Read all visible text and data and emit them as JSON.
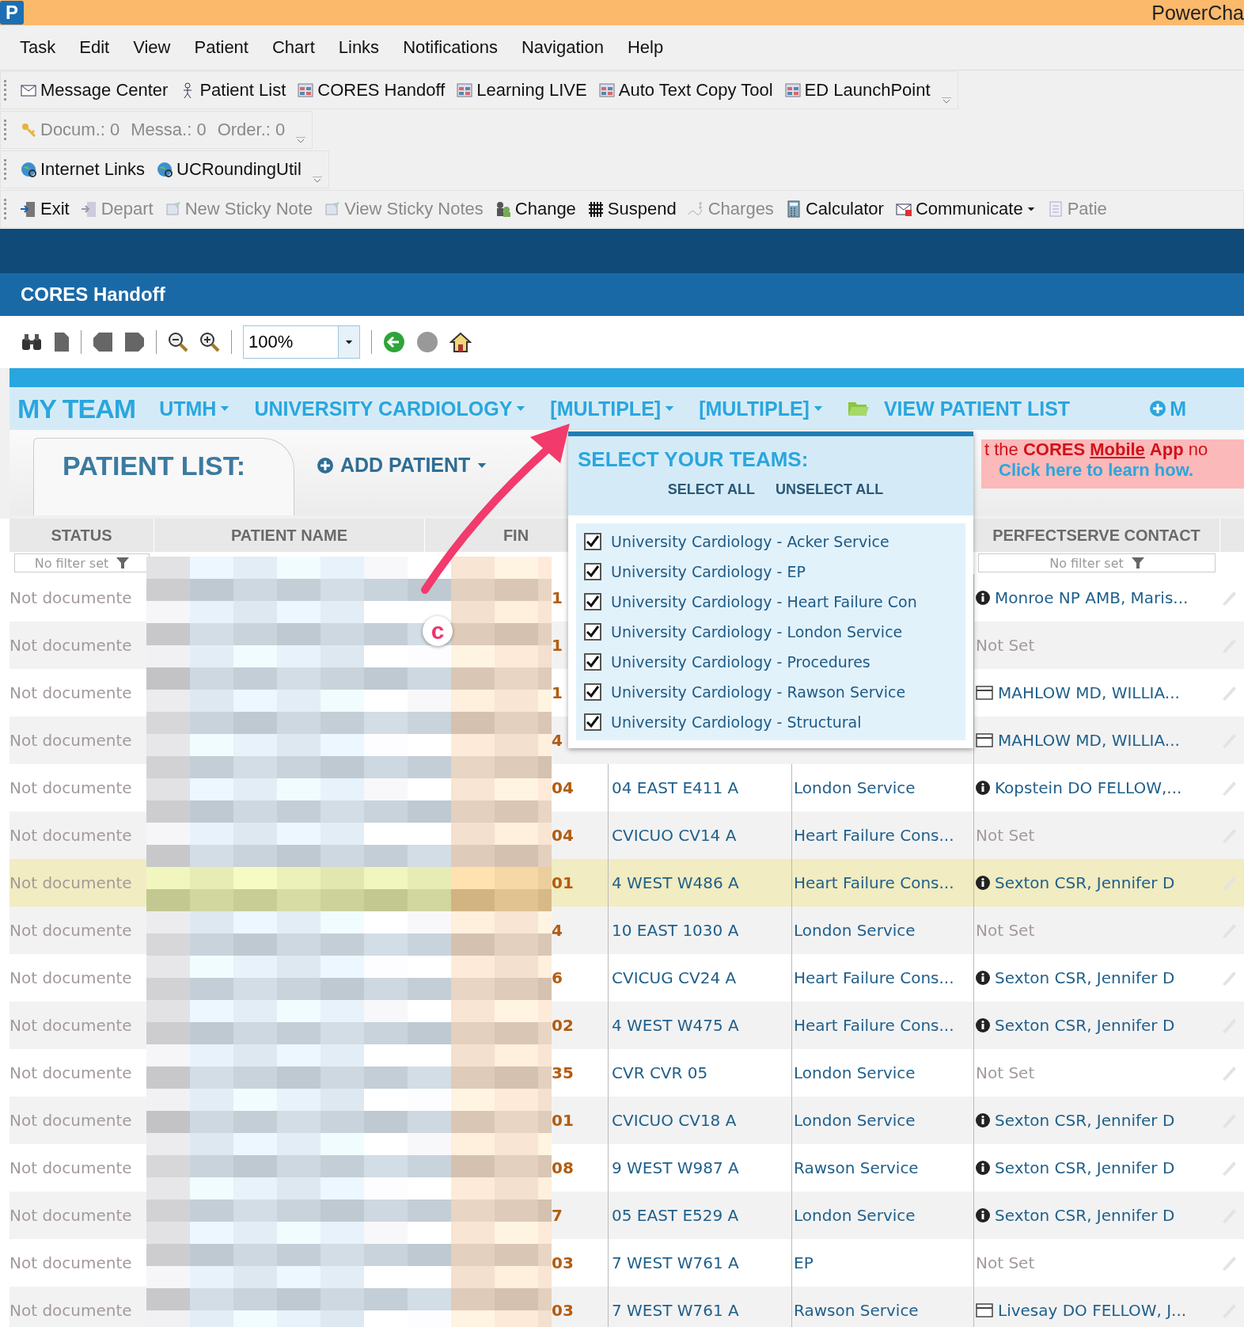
{
  "window": {
    "logo": "P",
    "title": "PowerCha"
  },
  "menu": [
    "Task",
    "Edit",
    "View",
    "Patient",
    "Chart",
    "Links",
    "Notifications",
    "Navigation",
    "Help"
  ],
  "toolbars": [
    {
      "items": [
        {
          "label": "Message Center",
          "kind": "message",
          "disabled": false
        },
        {
          "label": "Patient List",
          "kind": "person",
          "disabled": false
        },
        {
          "label": "CORES Handoff",
          "kind": "app",
          "disabled": false
        },
        {
          "label": "Learning LIVE",
          "kind": "app",
          "disabled": false
        },
        {
          "label": "Auto Text Copy Tool",
          "kind": "app",
          "disabled": false
        },
        {
          "label": "ED LaunchPoint",
          "kind": "app",
          "disabled": false
        }
      ]
    },
    {
      "items": [
        {
          "label": "Docum.: 0",
          "kind": "key",
          "disabled": true
        },
        {
          "label": "Messa.: 0",
          "kind": "text",
          "disabled": true
        },
        {
          "label": "Order.: 0",
          "kind": "text",
          "disabled": true
        }
      ]
    },
    {
      "items": [
        {
          "label": "Internet Links",
          "kind": "globe",
          "disabled": false
        },
        {
          "label": "UCRoundingUtil",
          "kind": "globe",
          "disabled": false
        }
      ]
    },
    {
      "items": [
        {
          "label": "Exit",
          "kind": "exit",
          "disabled": false
        },
        {
          "label": "Depart",
          "kind": "depart",
          "disabled": true
        },
        {
          "label": "New Sticky Note",
          "kind": "note",
          "disabled": true
        },
        {
          "label": "View Sticky Notes",
          "kind": "note",
          "disabled": true
        },
        {
          "label": "Change",
          "kind": "change",
          "disabled": false
        },
        {
          "label": "Suspend",
          "kind": "suspend",
          "disabled": false
        },
        {
          "label": "Charges",
          "kind": "charges",
          "disabled": true
        },
        {
          "label": "Calculator",
          "kind": "calculator",
          "disabled": false
        },
        {
          "label": "Communicate",
          "kind": "communicate",
          "disabled": false
        },
        {
          "label": "Patie",
          "kind": "document",
          "disabled": true
        }
      ]
    }
  ],
  "app_header": {
    "title": "CORES Handoff"
  },
  "viewer_toolbar": {
    "zoom": "100%"
  },
  "team_bar": {
    "title": "MY TEAM",
    "filters": [
      "UTMH",
      "UNIVERSITY CARDIOLOGY",
      "[MULTIPLE]",
      "[MULTIPLE]"
    ],
    "view_link": "VIEW PATIENT LIST",
    "more": "M"
  },
  "patient_list": {
    "tab": "PATIENT LIST:",
    "add": "ADD PATIENT"
  },
  "promo": {
    "before": "t the **CORES**",
    "link": "Mobile",
    "after": "**App** no",
    "cta": "Click here to learn how."
  },
  "table": {
    "columns": [
      {
        "label": "STATUS",
        "filter": "No filter set"
      },
      {
        "label": "PATIENT NAME"
      },
      {
        "label": "FIN"
      },
      {
        "label": "PERFECTSERVE CONTACT",
        "filter": "No filter set"
      }
    ],
    "rows": [
      {
        "status": "Not documente",
        "fin": "1",
        "contact": {
          "kind": "info",
          "text": "Monroe NP AMB, Maris..."
        },
        "selected": false
      },
      {
        "status": "Not documente",
        "fin": "1",
        "contact": {
          "kind": "none",
          "text": "Not Set"
        },
        "selected": false
      },
      {
        "status": "Not documente",
        "fin": "1",
        "contact": {
          "kind": "card",
          "text": "MAHLOW MD, WILLIA..."
        },
        "selected": false
      },
      {
        "status": "Not documente",
        "fin": "4",
        "contact": {
          "kind": "card",
          "text": "MAHLOW MD, WILLIA..."
        },
        "selected": false
      },
      {
        "status": "Not documente",
        "fin": "04",
        "location": "04 EAST E411 A",
        "service": "London Service",
        "contact": {
          "kind": "info",
          "text": "Kopstein DO FELLOW,..."
        },
        "selected": false
      },
      {
        "status": "Not documente",
        "fin": "04",
        "location": "CVICUO CV14 A",
        "service": "Heart Failure Cons...",
        "contact": {
          "kind": "none",
          "text": "Not Set"
        },
        "selected": false
      },
      {
        "status": "Not documente",
        "fin": "01",
        "location": "4 WEST W486 A",
        "service": "Heart Failure Cons...",
        "contact": {
          "kind": "info",
          "text": "Sexton CSR, Jennifer D"
        },
        "selected": true
      },
      {
        "status": "Not documente",
        "fin": "4",
        "location": "10 EAST 1030 A",
        "service": "London Service",
        "contact": {
          "kind": "none",
          "text": "Not Set"
        },
        "selected": false
      },
      {
        "status": "Not documente",
        "fin": "6",
        "location": "CVICUG CV24 A",
        "service": "Heart Failure Cons...",
        "contact": {
          "kind": "info",
          "text": "Sexton CSR, Jennifer D"
        },
        "selected": false
      },
      {
        "status": "Not documente",
        "fin": "02",
        "location": "4 WEST W475 A",
        "service": "Heart Failure Cons...",
        "contact": {
          "kind": "info",
          "text": "Sexton CSR, Jennifer D"
        },
        "selected": false
      },
      {
        "status": "Not documente",
        "fin": "35",
        "location": "CVR CVR 05",
        "service": "London Service",
        "contact": {
          "kind": "none",
          "text": "Not Set"
        },
        "selected": false
      },
      {
        "status": "Not documente",
        "fin": "01",
        "location": "CVICUO CV18 A",
        "service": "London Service",
        "contact": {
          "kind": "info",
          "text": "Sexton CSR, Jennifer D"
        },
        "selected": false
      },
      {
        "status": "Not documente",
        "fin": "08",
        "location": "9 WEST W987 A",
        "service": "Rawson Service",
        "contact": {
          "kind": "info",
          "text": "Sexton CSR, Jennifer D"
        },
        "selected": false
      },
      {
        "status": "Not documente",
        "fin": "7",
        "location": "05 EAST E529 A",
        "service": "London Service",
        "contact": {
          "kind": "info",
          "text": "Sexton CSR, Jennifer D"
        },
        "selected": false
      },
      {
        "status": "Not documente",
        "fin": "03",
        "location": "7 WEST W761 A",
        "service": "EP",
        "contact": {
          "kind": "none",
          "text": "Not Set"
        },
        "selected": false
      },
      {
        "status": "Not documente",
        "fin": "03",
        "location": "7 WEST W761 A",
        "service": "Rawson Service",
        "contact": {
          "kind": "card",
          "text": "Livesay DO FELLOW, J..."
        },
        "selected": false
      }
    ]
  },
  "team_dropdown": {
    "title": "SELECT YOUR TEAMS:",
    "select_all": "SELECT ALL",
    "unselect_all": "UNSELECT ALL",
    "teams": [
      {
        "label": "University Cardiology - Acker Service",
        "checked": true
      },
      {
        "label": "University Cardiology - EP",
        "checked": true
      },
      {
        "label": "University Cardiology - Heart Failure Con",
        "checked": true
      },
      {
        "label": "University Cardiology - London Service",
        "checked": true
      },
      {
        "label": "University Cardiology - Procedures",
        "checked": true
      },
      {
        "label": "University Cardiology - Rawson Service",
        "checked": true
      },
      {
        "label": "University Cardiology - Structural",
        "checked": true
      }
    ]
  },
  "annotation": {
    "label": "c"
  }
}
